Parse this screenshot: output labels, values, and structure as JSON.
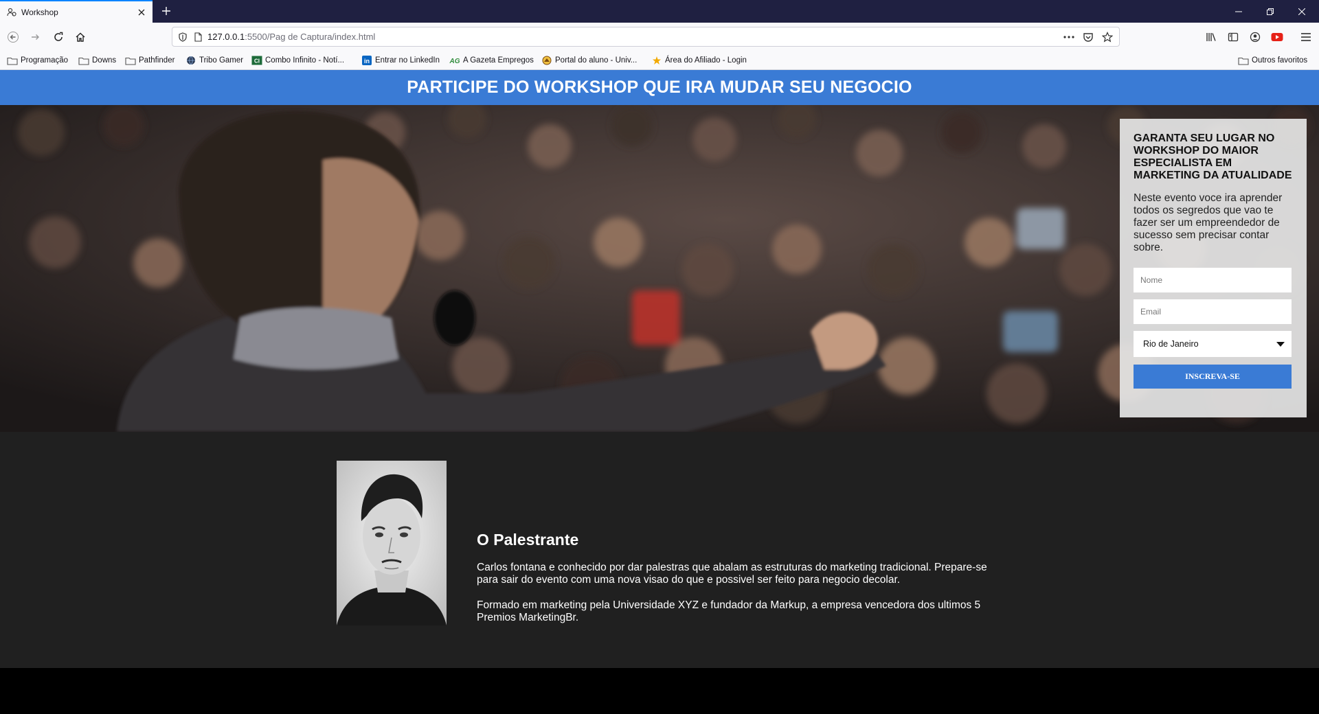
{
  "browser": {
    "tab_title": "Workshop",
    "url_host": "127.0.0.1",
    "url_path": ":5500/Pag de Captura/index.html",
    "bookmarks": [
      {
        "label": "Programação",
        "icon": "folder-icon"
      },
      {
        "label": "Downs",
        "icon": "folder-icon"
      },
      {
        "label": "Pathfinder",
        "icon": "folder-icon"
      },
      {
        "label": "Tribo Gamer",
        "icon": "globe-icon"
      },
      {
        "label": "Combo Infinito - Notí...",
        "icon": "site-icon"
      },
      {
        "label": "Entrar no LinkedIn",
        "icon": "linkedin-icon"
      },
      {
        "label": "A Gazeta Empregos",
        "icon": "gazeta-icon"
      },
      {
        "label": "Portal do aluno - Univ...",
        "icon": "portal-icon"
      },
      {
        "label": "Área do Afiliado - Login",
        "icon": "affiliate-icon"
      }
    ],
    "other_bookmarks": "Outros favoritos"
  },
  "page": {
    "banner_title": "PARTICIPE DO WORKSHOP QUE IRA MUDAR SEU NEGOCIO",
    "form": {
      "title": "GARANTA SEU LUGAR NO WORKSHOP DO MAIOR ESPECIALISTA EM MARKETING DA ATUALIDADE",
      "description": "Neste evento voce ira aprender todos os segredos que vao te fazer ser um empreendedor de sucesso sem precisar contar sobre.",
      "name_placeholder": "Nome",
      "email_placeholder": "Email",
      "city_value": "Rio de Janeiro",
      "submit_label": "INSCREVA-SE"
    },
    "speaker": {
      "heading": "O Palestrante",
      "paragraph_1": "Carlos fontana e conhecido por dar palestras que abalam as estruturas do marketing tradicional. Prepare-se para sair do evento com uma nova visao do que e possivel ser feito para negocio decolar.",
      "paragraph_2": "Formado em marketing pela Universidade XYZ e fundador da Markup, a empresa vencedora dos ultimos 5 Premios MarketingBr."
    }
  },
  "colors": {
    "accent": "#3a7bd5",
    "dark_section": "#202020",
    "tabbar": "#1f2041"
  }
}
